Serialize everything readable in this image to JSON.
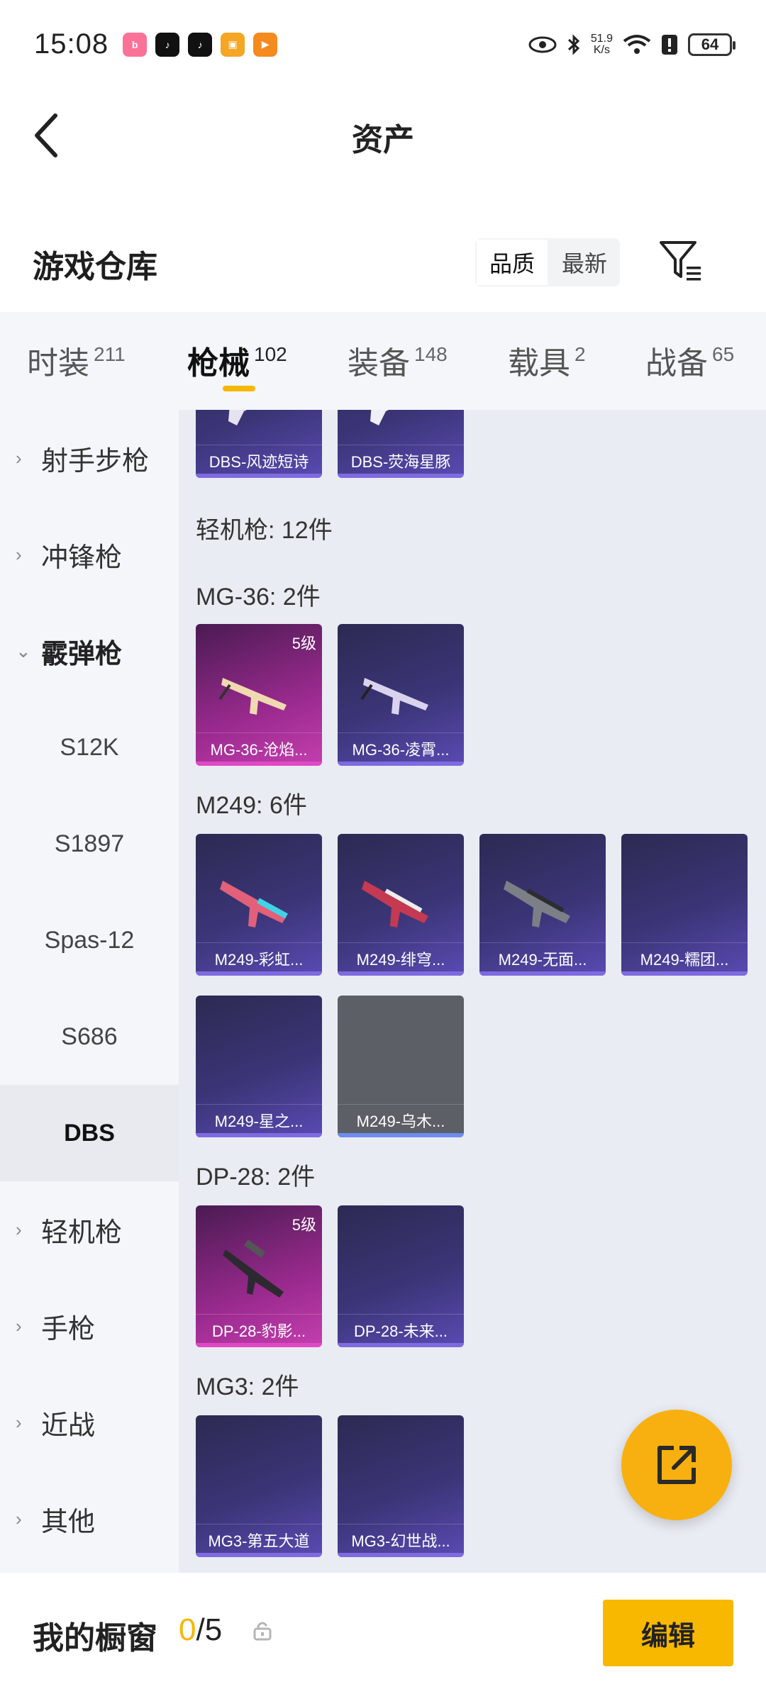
{
  "status_bar": {
    "time": "15:08",
    "net_speed_value": "51.9",
    "net_speed_unit": "K/s",
    "battery": "64",
    "icons": [
      "bilibili-icon",
      "tiktok-icon",
      "tiktok-icon",
      "game-icon",
      "video-icon",
      "eye-icon",
      "bluetooth-icon",
      "wifi-icon",
      "alert-icon",
      "battery-icon"
    ]
  },
  "header": {
    "title": "资产"
  },
  "warehouse": {
    "title": "游戏仓库",
    "sort_quality": "品质",
    "sort_latest": "最新"
  },
  "tabs": [
    {
      "label": "时装",
      "count": "211"
    },
    {
      "label": "枪械",
      "count": "102",
      "active": true
    },
    {
      "label": "装备",
      "count": "148"
    },
    {
      "label": "载具",
      "count": "2"
    },
    {
      "label": "战备",
      "count": "65"
    }
  ],
  "sidebar": [
    {
      "label": "射手步枪",
      "type": "collapsed"
    },
    {
      "label": "冲锋枪",
      "type": "collapsed"
    },
    {
      "label": "霰弹枪",
      "type": "expanded"
    },
    {
      "label": "S12K",
      "type": "sub"
    },
    {
      "label": "S1897",
      "type": "sub"
    },
    {
      "label": "Spas-12",
      "type": "sub"
    },
    {
      "label": "S686",
      "type": "sub"
    },
    {
      "label": "DBS",
      "type": "sub-active"
    },
    {
      "label": "轻机枪",
      "type": "collapsed"
    },
    {
      "label": "手枪",
      "type": "collapsed"
    },
    {
      "label": "近战",
      "type": "collapsed"
    },
    {
      "label": "其他",
      "type": "collapsed"
    }
  ],
  "content": {
    "top_cards": [
      "DBS-风迹短诗",
      "DBS-荧海星豚"
    ],
    "category_label": "轻机枪: 12件",
    "groups": [
      {
        "label": "MG-36: 2件",
        "cards": [
          {
            "name": "MG-36-沧焰...",
            "level": "5级",
            "style": "gold"
          },
          {
            "name": "MG-36-凌霄...",
            "style": "purple"
          }
        ]
      },
      {
        "label": "M249: 6件",
        "cards": [
          {
            "name": "M249-彩虹...",
            "style": "purple"
          },
          {
            "name": "M249-绯穹...",
            "style": "purple"
          },
          {
            "name": "M249-无面...",
            "style": "purple"
          },
          {
            "name": "M249-糯团...",
            "style": "purple"
          },
          {
            "name": "M249-星之...",
            "style": "purple"
          },
          {
            "name": "M249-乌木...",
            "style": "gray"
          }
        ]
      },
      {
        "label": "DP-28: 2件",
        "cards": [
          {
            "name": "DP-28-豹影...",
            "level": "5级",
            "style": "gold"
          },
          {
            "name": "DP-28-未来...",
            "style": "purple"
          }
        ]
      },
      {
        "label": "MG3: 2件",
        "cards": [
          {
            "name": "MG3-第五大道",
            "style": "purple"
          },
          {
            "name": "MG3-幻世战...",
            "style": "purple"
          }
        ]
      }
    ]
  },
  "bottom_bar": {
    "label": "我的橱窗",
    "current": "0",
    "total": "/5",
    "edit_label": "编辑"
  },
  "colors": {
    "accent": "#f5b700",
    "card_purple": "#3b3577",
    "card_gold": "#9a2a8e"
  }
}
